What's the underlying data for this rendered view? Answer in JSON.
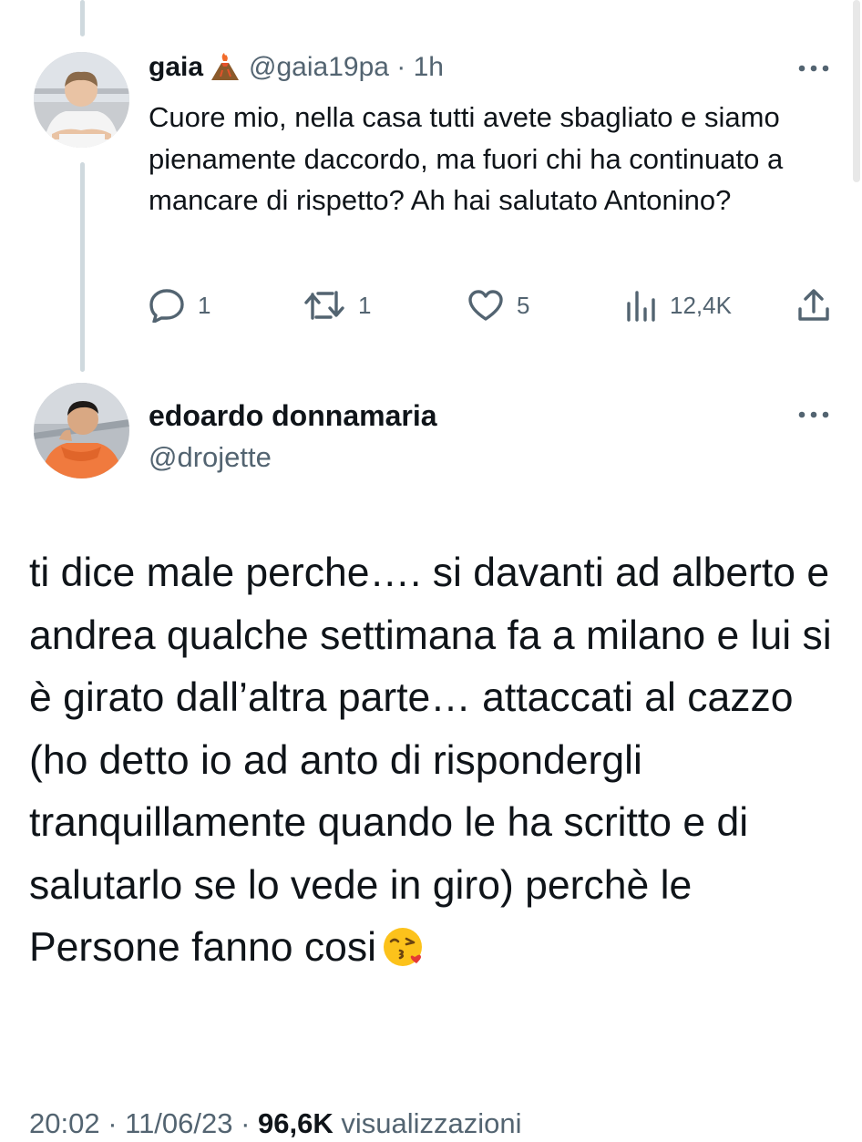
{
  "reply_tweet": {
    "author_name": "gaia",
    "handle_time": "@gaia19pa · 1h",
    "text": "Cuore mio, nella casa tutti avete sbagliato e siamo pienamente daccordo, ma fuori chi ha continuato a mancare di rispetto? Ah hai salutato Antonino?",
    "actions": {
      "replies": "1",
      "retweets": "1",
      "likes": "5",
      "views": "12,4K"
    },
    "icons": [
      "volcano-emoji",
      "more-icon",
      "reply-icon",
      "retweet-icon",
      "like-icon",
      "views-icon",
      "share-icon"
    ]
  },
  "main_tweet": {
    "author_name": "edoardo donnamaria",
    "handle": "@drojette",
    "text": "ti dice male perche…. si davanti ad alberto e andrea qualche settimana fa a milano e lui si è girato dall’altra parte… attaccati al cazzo (ho detto io ad anto di rispondergli tranquillamente quando le ha scritto e di salutarlo se lo vede in giro) perchè le Persone fanno cosi",
    "emoji": "kissing-face-emoji",
    "meta_prefix": "20:02 · 11/06/23 · ",
    "views_count": "96,6K",
    "views_label": " visualizzazioni"
  },
  "colors": {
    "text": "#0f1419",
    "muted": "#536471",
    "thread_line": "#cfd9de",
    "background": "#ffffff"
  }
}
